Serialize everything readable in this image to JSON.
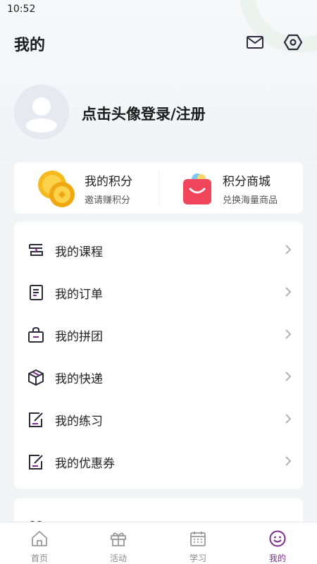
{
  "status_bar": {
    "time": "10:52"
  },
  "header": {
    "title": "我的",
    "mail_icon": "mail-icon",
    "settings_icon": "settings-hex-icon"
  },
  "profile": {
    "avatar_icon": "avatar-placeholder-icon",
    "login_text": "点击头像登录/注册"
  },
  "points": {
    "my_points": {
      "title": "我的积分",
      "subtitle": "邀请赚积分",
      "icon": "coins-icon"
    },
    "points_mall": {
      "title": "积分商城",
      "subtitle": "兑换海量商品",
      "icon": "shopping-bag-icon"
    }
  },
  "menu": {
    "items": [
      {
        "label": "我的课程",
        "icon": "course-icon"
      },
      {
        "label": "我的订单",
        "icon": "order-icon"
      },
      {
        "label": "我的拼团",
        "icon": "group-buy-icon"
      },
      {
        "label": "我的快递",
        "icon": "package-icon"
      },
      {
        "label": "我的练习",
        "icon": "practice-icon"
      },
      {
        "label": "我的优惠券",
        "icon": "coupon-icon"
      }
    ]
  },
  "card3": {
    "label": "",
    "icon": "people-icon"
  },
  "tabbar": {
    "tabs": [
      {
        "label": "首页",
        "icon": "home-icon"
      },
      {
        "label": "活动",
        "icon": "gift-icon"
      },
      {
        "label": "学习",
        "icon": "calendar-icon"
      },
      {
        "label": "我的",
        "icon": "smile-icon"
      }
    ],
    "active": "我的"
  },
  "colors": {
    "accent": "#7b2c8c",
    "icon_dark": "#2f2a3a",
    "background": "#f3f4f6"
  }
}
